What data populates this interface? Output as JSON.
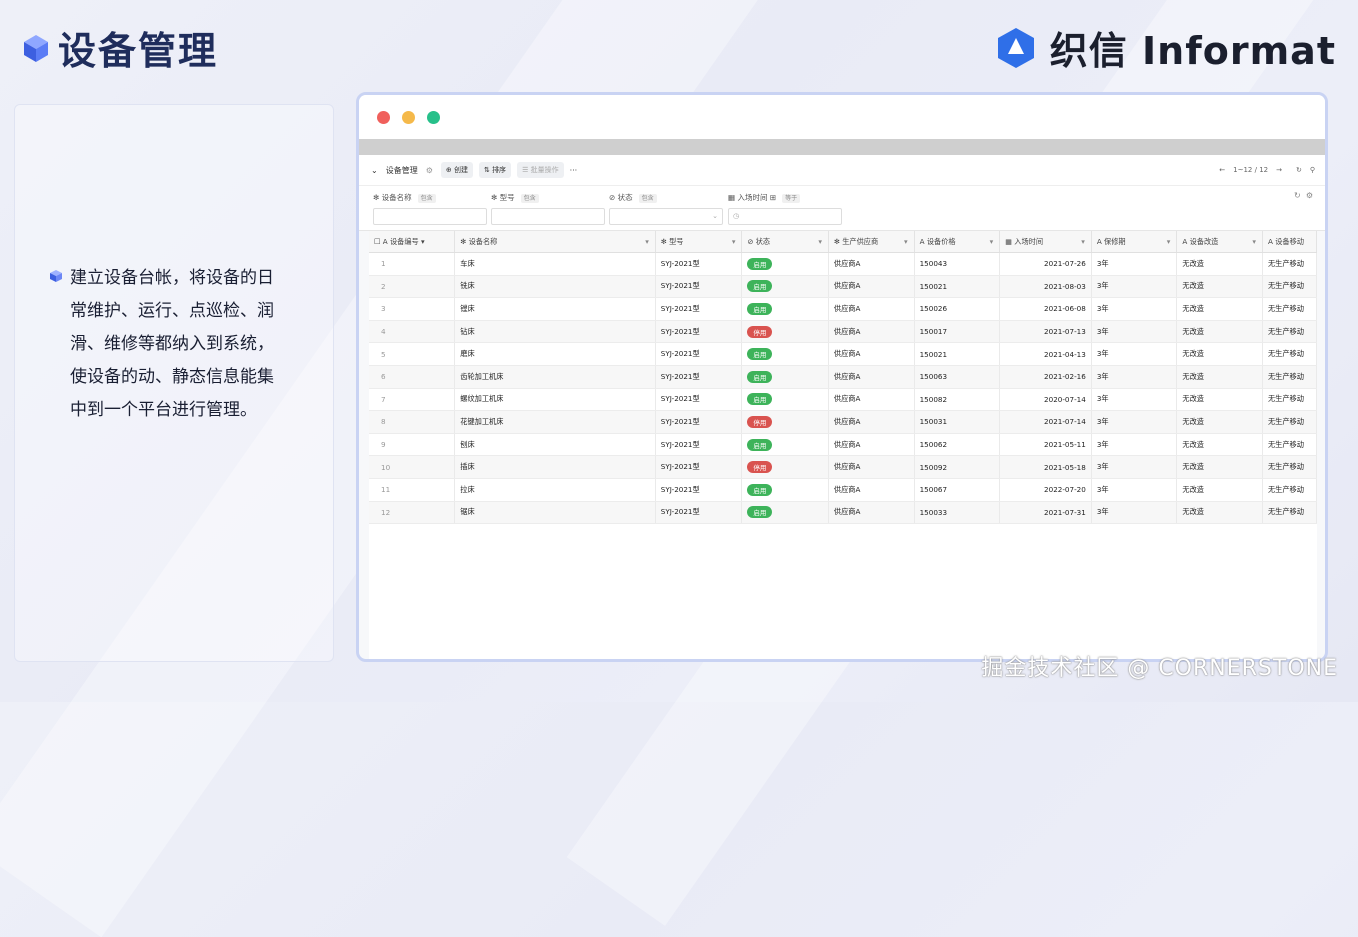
{
  "header": {
    "title": "设备管理",
    "brand": "织信 Informat"
  },
  "description": "建立设备台帐，将设备的日常维护、运行、点巡检、润滑、维修等都纳入到系统，使设备的动、静态信息能集中到一个平台进行管理。",
  "app": {
    "toolbar": {
      "view_name": "设备管理",
      "create": "创建",
      "sort": "排序",
      "batch": "批量操作",
      "more": "···",
      "pagination": "1~12 / 12"
    },
    "filters": [
      {
        "label": "设备名称",
        "op": "包含"
      },
      {
        "label": "型号",
        "op": "包含"
      },
      {
        "label": "状态",
        "op": "包含"
      },
      {
        "label": "入场时间",
        "op": "等于"
      }
    ],
    "columns": [
      "设备编号",
      "设备名称",
      "型号",
      "状态",
      "生产供应商",
      "设备价格",
      "入场时间",
      "保修期",
      "设备改造",
      "设备移动"
    ],
    "rows": [
      {
        "no": "1",
        "name": "车床",
        "model": "SYJ-2021型",
        "status": "启用",
        "supplier": "供应商A",
        "price": "150043",
        "date": "2021-07-26",
        "warranty": "3年",
        "mod": "无改造",
        "move": "无生产移动"
      },
      {
        "no": "2",
        "name": "铣床",
        "model": "SYJ-2021型",
        "status": "启用",
        "supplier": "供应商A",
        "price": "150021",
        "date": "2021-08-03",
        "warranty": "3年",
        "mod": "无改造",
        "move": "无生产移动"
      },
      {
        "no": "3",
        "name": "镗床",
        "model": "SYJ-2021型",
        "status": "启用",
        "supplier": "供应商A",
        "price": "150026",
        "date": "2021-06-08",
        "warranty": "3年",
        "mod": "无改造",
        "move": "无生产移动"
      },
      {
        "no": "4",
        "name": "钻床",
        "model": "SYJ-2021型",
        "status": "停用",
        "supplier": "供应商A",
        "price": "150017",
        "date": "2021-07-13",
        "warranty": "3年",
        "mod": "无改造",
        "move": "无生产移动"
      },
      {
        "no": "5",
        "name": "磨床",
        "model": "SYJ-2021型",
        "status": "启用",
        "supplier": "供应商A",
        "price": "150021",
        "date": "2021-04-13",
        "warranty": "3年",
        "mod": "无改造",
        "move": "无生产移动"
      },
      {
        "no": "6",
        "name": "齿轮加工机床",
        "model": "SYJ-2021型",
        "status": "启用",
        "supplier": "供应商A",
        "price": "150063",
        "date": "2021-02-16",
        "warranty": "3年",
        "mod": "无改造",
        "move": "无生产移动"
      },
      {
        "no": "7",
        "name": "螺纹加工机床",
        "model": "SYJ-2021型",
        "status": "启用",
        "supplier": "供应商A",
        "price": "150082",
        "date": "2020-07-14",
        "warranty": "3年",
        "mod": "无改造",
        "move": "无生产移动"
      },
      {
        "no": "8",
        "name": "花键加工机床",
        "model": "SYJ-2021型",
        "status": "停用",
        "supplier": "供应商A",
        "price": "150031",
        "date": "2021-07-14",
        "warranty": "3年",
        "mod": "无改造",
        "move": "无生产移动"
      },
      {
        "no": "9",
        "name": "刨床",
        "model": "SYJ-2021型",
        "status": "启用",
        "supplier": "供应商A",
        "price": "150062",
        "date": "2021-05-11",
        "warranty": "3年",
        "mod": "无改造",
        "move": "无生产移动"
      },
      {
        "no": "10",
        "name": "插床",
        "model": "SYJ-2021型",
        "status": "停用",
        "supplier": "供应商A",
        "price": "150092",
        "date": "2021-05-18",
        "warranty": "3年",
        "mod": "无改造",
        "move": "无生产移动"
      },
      {
        "no": "11",
        "name": "拉床",
        "model": "SYJ-2021型",
        "status": "启用",
        "supplier": "供应商A",
        "price": "150067",
        "date": "2022-07-20",
        "warranty": "3年",
        "mod": "无改造",
        "move": "无生产移动"
      },
      {
        "no": "12",
        "name": "锯床",
        "model": "SYJ-2021型",
        "status": "启用",
        "supplier": "供应商A",
        "price": "150033",
        "date": "2021-07-31",
        "warranty": "3年",
        "mod": "无改造",
        "move": "无生产移动"
      }
    ]
  },
  "watermark": "掘金技术社区 @ CORNERSTONE",
  "colors": {
    "title": "#1f2d5c",
    "brand_blue": "#2f6fe8",
    "status_on": "#3db35a",
    "status_off": "#d9534f"
  }
}
